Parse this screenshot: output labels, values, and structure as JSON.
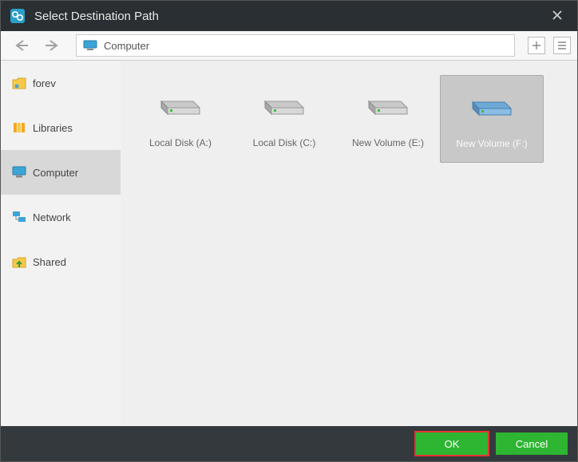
{
  "title": "Select Destination Path",
  "path_label": "Computer",
  "sidebar": {
    "items": [
      {
        "label": "forev",
        "icon": "user-folder-icon"
      },
      {
        "label": "Libraries",
        "icon": "libraries-icon"
      },
      {
        "label": "Computer",
        "icon": "computer-icon",
        "selected": true
      },
      {
        "label": "Network",
        "icon": "network-icon"
      },
      {
        "label": "Shared",
        "icon": "shared-icon"
      }
    ]
  },
  "drives": [
    {
      "label": "Local Disk (A:)",
      "selected": false,
      "color": "gray"
    },
    {
      "label": "Local Disk (C:)",
      "selected": false,
      "color": "gray"
    },
    {
      "label": "New Volume (E:)",
      "selected": false,
      "color": "gray"
    },
    {
      "label": "New Volume (F:)",
      "selected": true,
      "color": "blue"
    }
  ],
  "buttons": {
    "ok": "OK",
    "cancel": "Cancel"
  }
}
